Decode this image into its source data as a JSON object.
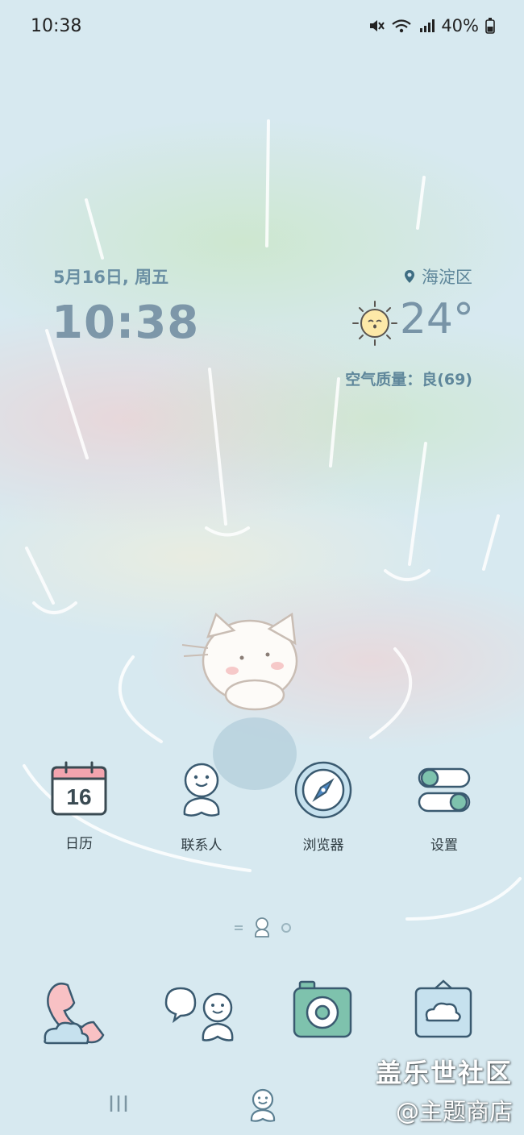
{
  "status_bar": {
    "time": "10:38",
    "battery": "40%"
  },
  "widget": {
    "date": "5月16日, 周五",
    "time": "10:38",
    "location": "海淀区",
    "temperature": "24°",
    "air_quality": "空气质量：良(69)"
  },
  "apps": [
    {
      "label": "日历",
      "calendar_day": "16"
    },
    {
      "label": "联系人"
    },
    {
      "label": "浏览器"
    },
    {
      "label": "设置"
    }
  ],
  "dock": [
    {
      "icon": "phone-icon"
    },
    {
      "icon": "messages-icon"
    },
    {
      "icon": "camera-icon"
    },
    {
      "icon": "gallery-icon"
    }
  ],
  "watermark": {
    "line1": "盖乐世社区",
    "line2": "@主题商店"
  },
  "colors": {
    "background": "#d7e9f0",
    "accent": "#5f879b",
    "teal": "#6fb9a6"
  }
}
